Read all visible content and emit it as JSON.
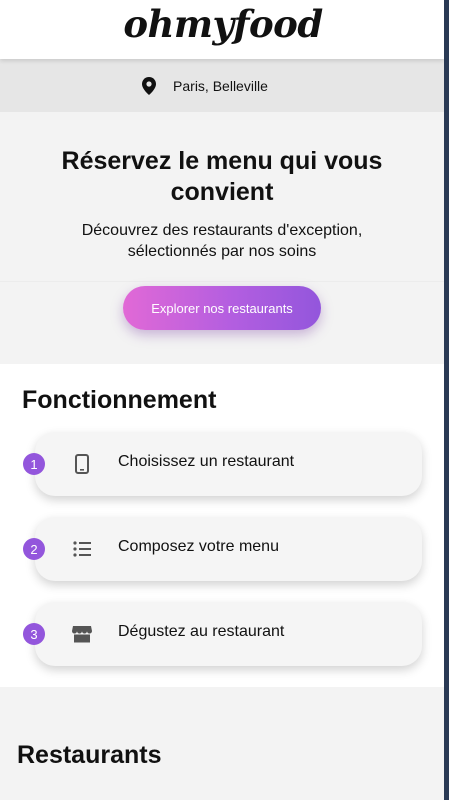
{
  "header": {
    "logo": "ohmyfood"
  },
  "location": {
    "icon": "map-pin-icon",
    "text": "Paris, Belleville"
  },
  "hero": {
    "title": "Réservez le menu qui vous convient",
    "subtitle": "Découvrez des restaurants d'exception, sélectionnés par nos soins",
    "cta_label": "Explorer nos restaurants"
  },
  "how": {
    "title": "Fonctionnement",
    "steps": [
      {
        "number": "1",
        "icon": "phone-icon",
        "label": "Choisissez un restaurant"
      },
      {
        "number": "2",
        "icon": "list-icon",
        "label": "Composez votre menu"
      },
      {
        "number": "3",
        "icon": "store-icon",
        "label": "Dégustez au restaurant"
      }
    ]
  },
  "restaurants": {
    "title": "Restaurants"
  },
  "colors": {
    "accent": "#9356dc",
    "accent_pink": "#e169d6"
  }
}
